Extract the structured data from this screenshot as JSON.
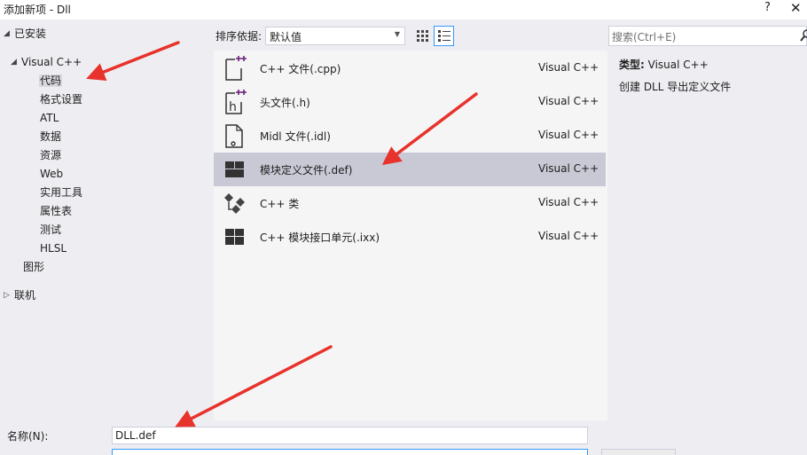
{
  "window": {
    "title": "添加新项 - Dll",
    "help": "?",
    "close": "✕"
  },
  "tree": {
    "installed": "已安装",
    "visual_cpp": "Visual C++",
    "children": [
      "代码",
      "格式设置",
      "ATL",
      "数据",
      "资源",
      "Web",
      "实用工具",
      "属性表",
      "测试",
      "HLSL"
    ],
    "graphics": "图形",
    "online": "联机"
  },
  "sortbar": {
    "label": "排序依据:",
    "value": "默认值"
  },
  "search": {
    "placeholder": "搜索(Ctrl+E)"
  },
  "templates": [
    {
      "name": "C++ 文件(.cpp)",
      "lang": "Visual C++",
      "icon": "cpp-file-icon"
    },
    {
      "name": "头文件(.h)",
      "lang": "Visual C++",
      "icon": "header-file-icon"
    },
    {
      "name": "Midl 文件(.idl)",
      "lang": "Visual C++",
      "icon": "idl-file-icon"
    },
    {
      "name": "模块定义文件(.def)",
      "lang": "Visual C++",
      "icon": "module-def-icon"
    },
    {
      "name": "C++ 类",
      "lang": "Visual C++",
      "icon": "class-icon"
    },
    {
      "name": "C++ 模块接口单元(.ixx)",
      "lang": "Visual C++",
      "icon": "module-interface-icon"
    }
  ],
  "details": {
    "type_key": "类型:",
    "type_value": "Visual C++",
    "description": "创建 DLL 导出定义文件"
  },
  "form": {
    "name_label": "名称(N):",
    "name_value": "DLL.def"
  },
  "colors": {
    "accent": "#3399ff",
    "selection": "#c9c9d6",
    "annotation": "#e8322c",
    "icon_plus": "#68217a"
  }
}
